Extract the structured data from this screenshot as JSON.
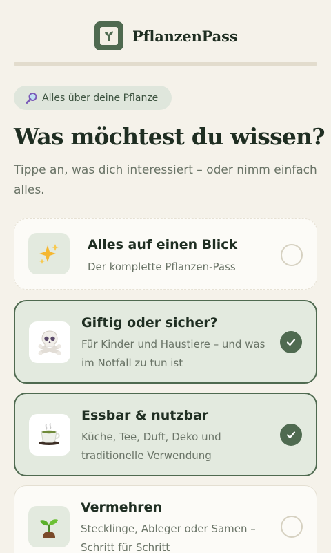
{
  "header": {
    "app_name": "PflanzenPass",
    "logo_icon": "sprout-icon"
  },
  "intro": {
    "pill_icon": "magnifying-glass-icon",
    "pill_text": "Alles über deine Pflanze",
    "title": "Was möchtest du wissen?",
    "subtitle": "Tippe an, was dich interessiert – oder nimm einfach alles."
  },
  "options": [
    {
      "icon": "sparkles-icon",
      "title": "Alles auf einen Blick",
      "description": "Der komplette Pflanzen-Pass",
      "selected": false
    },
    {
      "icon": "skull-crossbones-icon",
      "title": "Giftig oder sicher?",
      "description": "Für Kinder und Haustiere – und was im Notfall zu tun ist",
      "selected": true
    },
    {
      "icon": "teacup-icon",
      "title": "Essbar & nutzbar",
      "description": "Küche, Tee, Duft, Deko und traditionelle Verwendung",
      "selected": true
    },
    {
      "icon": "seedling-icon",
      "title": "Vermehren",
      "description": "Stecklinge, Ableger oder Samen – Schritt für Schritt",
      "selected": false
    }
  ],
  "colors": {
    "accent": "#4f6a50",
    "background": "#f5f2ea",
    "selected_bg": "#e3eadf"
  }
}
